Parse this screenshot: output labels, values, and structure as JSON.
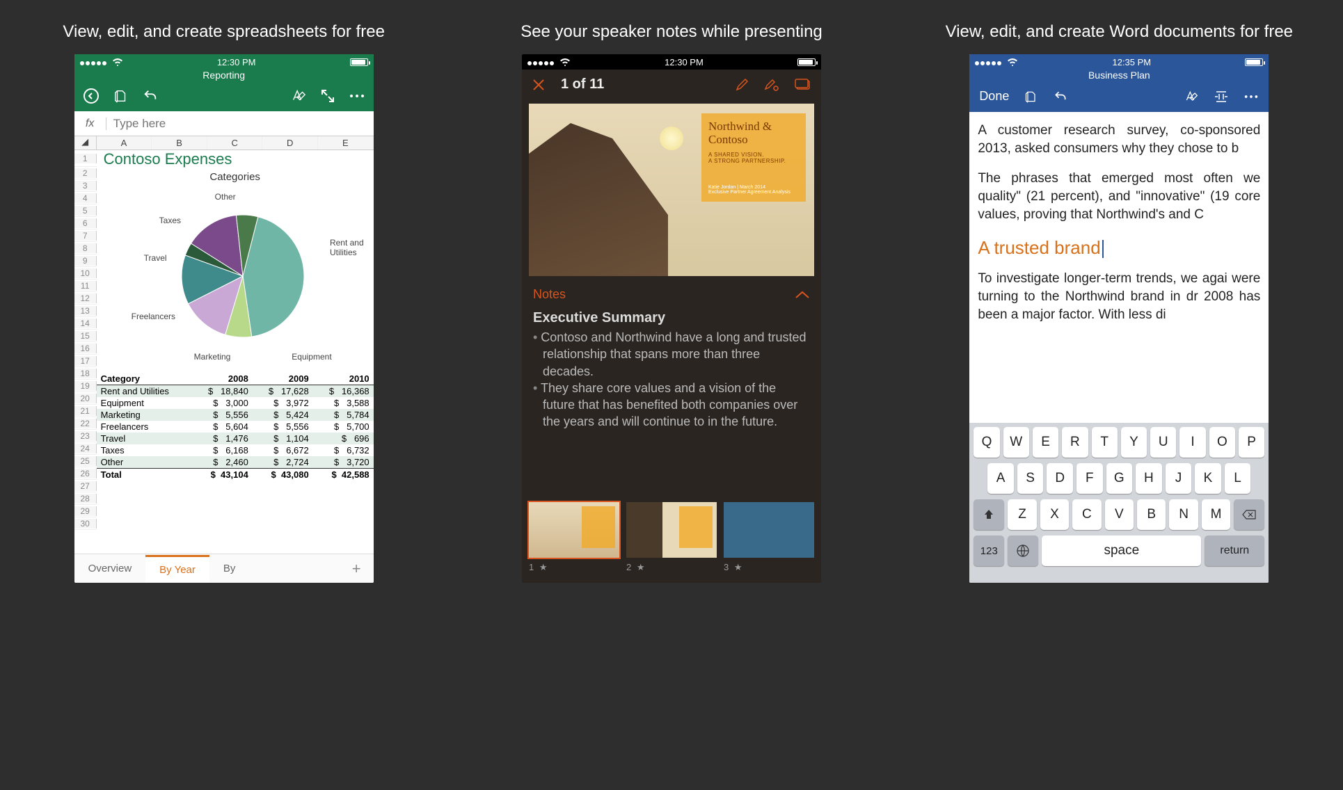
{
  "panels": {
    "excel": {
      "caption": "View, edit, and create spreadsheets for free",
      "status_time": "12:30 PM",
      "doc_title": "Reporting",
      "fx_label": "fx",
      "fx_placeholder": "Type here",
      "columns": [
        "A",
        "B",
        "C",
        "D",
        "E"
      ],
      "sheet_heading": "Contoso Expenses",
      "chart_title": "Categories",
      "table": {
        "head": [
          "Category",
          "2008",
          "2009",
          "2010"
        ],
        "rows": [
          {
            "cat": "Rent and Utilities",
            "y1": "18,840",
            "y2": "17,628",
            "y3": "16,368"
          },
          {
            "cat": "Equipment",
            "y1": "3,000",
            "y2": "3,972",
            "y3": "3,588"
          },
          {
            "cat": "Marketing",
            "y1": "5,556",
            "y2": "5,424",
            "y3": "5,784"
          },
          {
            "cat": "Freelancers",
            "y1": "5,604",
            "y2": "5,556",
            "y3": "5,700"
          },
          {
            "cat": "Travel",
            "y1": "1,476",
            "y2": "1,104",
            "y3": "696"
          },
          {
            "cat": "Taxes",
            "y1": "6,168",
            "y2": "6,672",
            "y3": "6,732"
          },
          {
            "cat": "Other",
            "y1": "2,460",
            "y2": "2,724",
            "y3": "3,720"
          }
        ],
        "total": {
          "cat": "Total",
          "y1": "43,104",
          "y2": "43,080",
          "y3": "42,588"
        }
      },
      "tabs": {
        "t1": "Overview",
        "t2": "By Year",
        "t3": "By",
        "add": "+"
      },
      "row_start": 1,
      "row_end": 30
    },
    "ppt": {
      "caption": "See your speaker notes while presenting",
      "status_time": "12:30 PM",
      "counter": "1 of 11",
      "slide_title": "Northwind & Contoso",
      "slide_sub1": "A SHARED VISION.",
      "slide_sub2": "A STRONG PARTNERSHIP.",
      "slide_meta1": "Katie Jordan | March 2014",
      "slide_meta2": "Exclusive Partner Agreement Analysis",
      "notes_label": "Notes",
      "notes_heading": "Executive Summary",
      "notes_bullets": [
        "Contoso and Northwind have a long and trusted relationship that spans more than three decades.",
        "They share core values and a vision of the future that has benefited both companies over the years and will continue to in the future."
      ],
      "thumb_labels": [
        "1",
        "2",
        "3"
      ]
    },
    "word": {
      "caption": "View, edit, and create Word documents for free",
      "status_time": "12:35 PM",
      "doc_title": "Business Plan",
      "done_label": "Done",
      "para1": "A customer research survey, co-sponsored 2013, asked consumers why they chose to b",
      "para2": "The phrases that emerged most often we quality\" (21 percent), and \"innovative\" (19 core values, proving that Northwind's and C",
      "heading": "A trusted brand",
      "para3": "To investigate longer-term trends, we agai were turning to the Northwind brand in dr 2008 has been a major factor. With less di",
      "keys": {
        "row1": [
          "Q",
          "W",
          "E",
          "R",
          "T",
          "Y",
          "U",
          "I",
          "O",
          "P"
        ],
        "row2": [
          "A",
          "S",
          "D",
          "F",
          "G",
          "H",
          "J",
          "K",
          "L"
        ],
        "row3": [
          "Z",
          "X",
          "C",
          "V",
          "B",
          "N",
          "M"
        ],
        "space": "space",
        "return": "return",
        "num": "123"
      }
    }
  },
  "chart_data": {
    "type": "pie",
    "title": "Categories",
    "categories": [
      "Rent and Utilities",
      "Equipment",
      "Marketing",
      "Freelancers",
      "Travel",
      "Taxes",
      "Other"
    ],
    "values": [
      18840,
      3000,
      5556,
      5604,
      1476,
      6168,
      2460
    ],
    "colors": [
      "#6fb6a6",
      "#b8d98a",
      "#c9a8d6",
      "#3f8a8a",
      "#2a5a3a",
      "#7a4a8a",
      "#4a7a4a"
    ]
  }
}
